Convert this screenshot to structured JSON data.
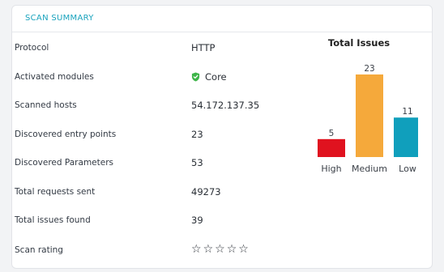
{
  "header": {
    "title": "SCAN SUMMARY"
  },
  "rows": [
    {
      "label": "Protocol",
      "value": "HTTP"
    },
    {
      "label": "Activated modules",
      "value": "Core",
      "icon": "shield-check-icon"
    },
    {
      "label": "Scanned hosts",
      "value": "54.172.137.35"
    },
    {
      "label": "Discovered entry points",
      "value": "23"
    },
    {
      "label": "Discovered Parameters",
      "value": "53"
    },
    {
      "label": "Total requests sent",
      "value": "49273"
    },
    {
      "label": "Total issues found",
      "value": "39"
    },
    {
      "label": "Scan rating",
      "stars_total": 5,
      "stars_filled": 0
    }
  ],
  "colors": {
    "accent": "#19a3bd",
    "shield": "#3fb54a",
    "high": "#e0121f",
    "medium": "#f5a93b",
    "low": "#109fbc"
  },
  "chart_data": {
    "type": "bar",
    "title": "Total Issues",
    "categories": [
      "High",
      "Medium",
      "Low"
    ],
    "values": [
      5,
      23,
      11
    ],
    "colors": [
      "#e0121f",
      "#f5a93b",
      "#109fbc"
    ],
    "data_labels": true,
    "grid": false,
    "ylim": [
      0,
      23
    ]
  }
}
